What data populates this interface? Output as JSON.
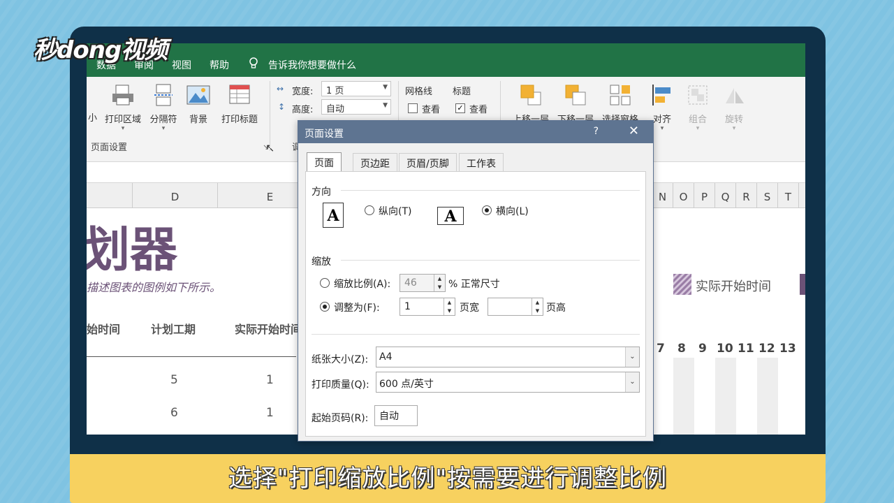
{
  "logo": "秒dong视频",
  "caption": "选择\"打印缩放比例\"按需要进行调整比例",
  "ribbon_tabs": [
    "数据",
    "审阅",
    "视图",
    "帮助"
  ],
  "tellme": "告诉我你想要做什么",
  "ribbon": {
    "small_cut": "小",
    "print_area": "打印区域",
    "breaks": "分隔符",
    "background": "背景",
    "print_titles": "打印标题",
    "page_setup_group": "页面设置",
    "scale_group_cut": "调",
    "width_label": "宽度:",
    "width_value": "1 页",
    "height_label": "高度:",
    "height_value": "自动",
    "gridlines": "网格线",
    "headings": "标题",
    "view1": "查看",
    "view2": "查看",
    "bring_forward": "上移一层",
    "send_backward": "下移一层",
    "selection_pane": "选择窗格",
    "align": "对齐",
    "group": "组合",
    "rotate": "旋转"
  },
  "sheet": {
    "columns_left": [
      "D",
      "E"
    ],
    "columns_right": [
      "N",
      "O",
      "P",
      "Q",
      "R",
      "S",
      "T"
    ],
    "title_fragment": "划器",
    "description": "描述图表的图例如下所示。",
    "headers": [
      "始时间",
      "计划工期",
      "实际开始时间"
    ],
    "rows": [
      [
        "5",
        "1"
      ],
      [
        "6",
        "1"
      ]
    ],
    "legend_label": "实际开始时间",
    "day_numbers": [
      "7",
      "8",
      "9",
      "10",
      "11",
      "12",
      "13"
    ]
  },
  "dialog": {
    "title": "页面设置",
    "help": "?",
    "close": "✕",
    "tabs": [
      "页面",
      "页边距",
      "页眉/页脚",
      "工作表"
    ],
    "orientation_label": "方向",
    "portrait": "纵向(T)",
    "landscape": "横向(L)",
    "scaling_label": "缩放",
    "adjust_to": "缩放比例(A):",
    "adjust_value": "46",
    "normal_size": "% 正常尺寸",
    "fit_to": "调整为(F):",
    "fit_pages_wide": "1",
    "pages_wide": "页宽",
    "fit_pages_tall": "",
    "pages_tall": "页高",
    "paper_size_label": "纸张大小(Z):",
    "paper_size": "A4",
    "print_quality_label": "打印质量(Q):",
    "print_quality": "600 点/英寸",
    "first_page_label": "起始页码(R):",
    "first_page": "自动",
    "page_glyph": "A"
  }
}
